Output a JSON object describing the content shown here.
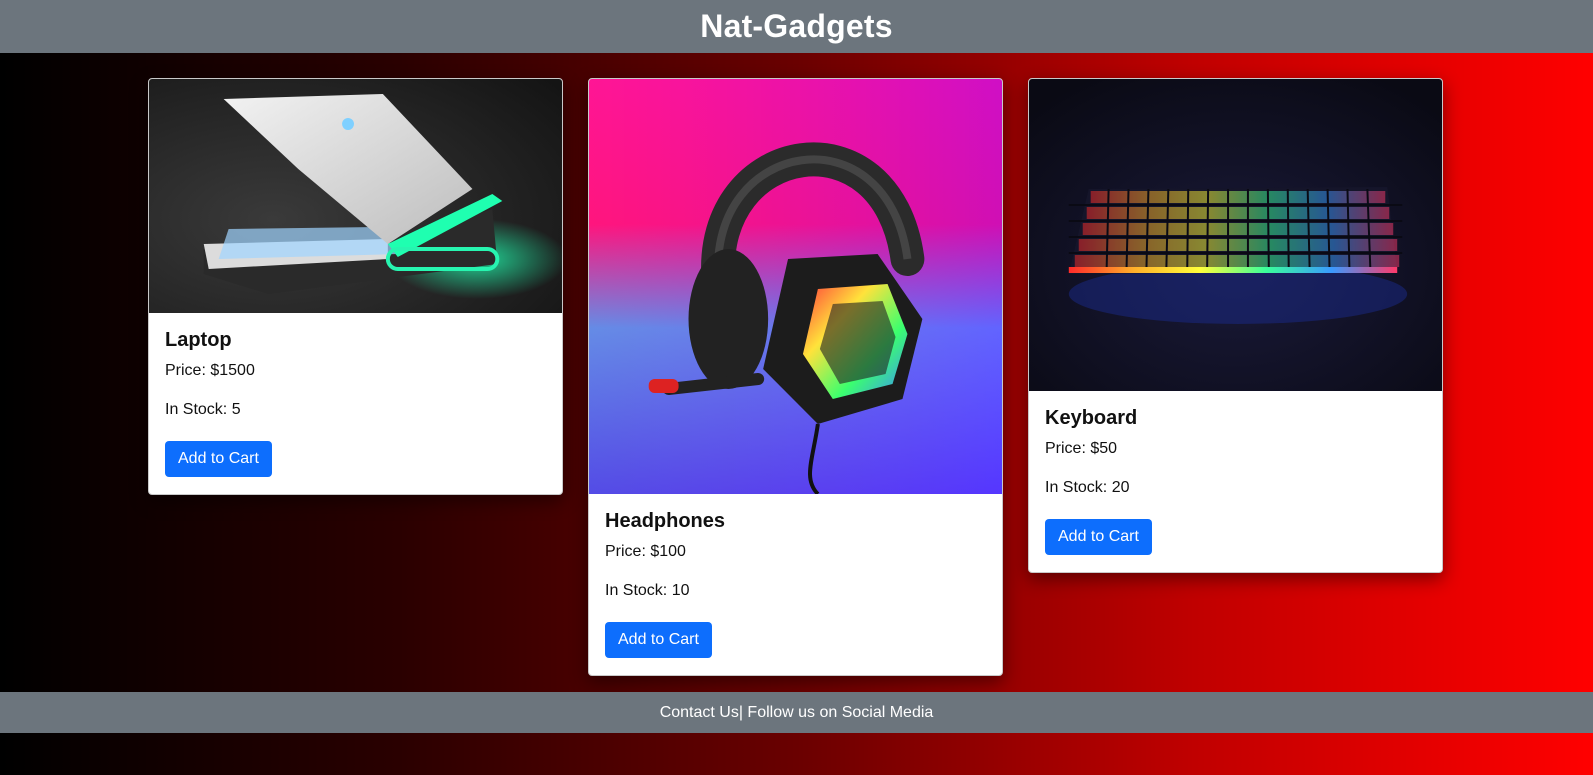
{
  "header": {
    "title": "Nat-Gadgets"
  },
  "products": [
    {
      "name": "Laptop",
      "price_label": "Price: $1500",
      "stock_label": "In Stock: 5",
      "button_label": "Add to Cart",
      "image_icon": "laptop-image"
    },
    {
      "name": "Headphones",
      "price_label": "Price: $100",
      "stock_label": "In Stock: 10",
      "button_label": "Add to Cart",
      "image_icon": "headphones-image"
    },
    {
      "name": "Keyboard",
      "price_label": "Price: $50",
      "stock_label": "In Stock: 20",
      "button_label": "Add to Cart",
      "image_icon": "keyboard-image"
    }
  ],
  "footer": {
    "contact_label": "Contact Us",
    "separator": "|",
    "social_label": " Follow us on Social Media"
  },
  "colors": {
    "header_bg": "#6c757d",
    "button_bg": "#0d6efd",
    "gradient_start": "#000000",
    "gradient_end": "#ff0000"
  }
}
